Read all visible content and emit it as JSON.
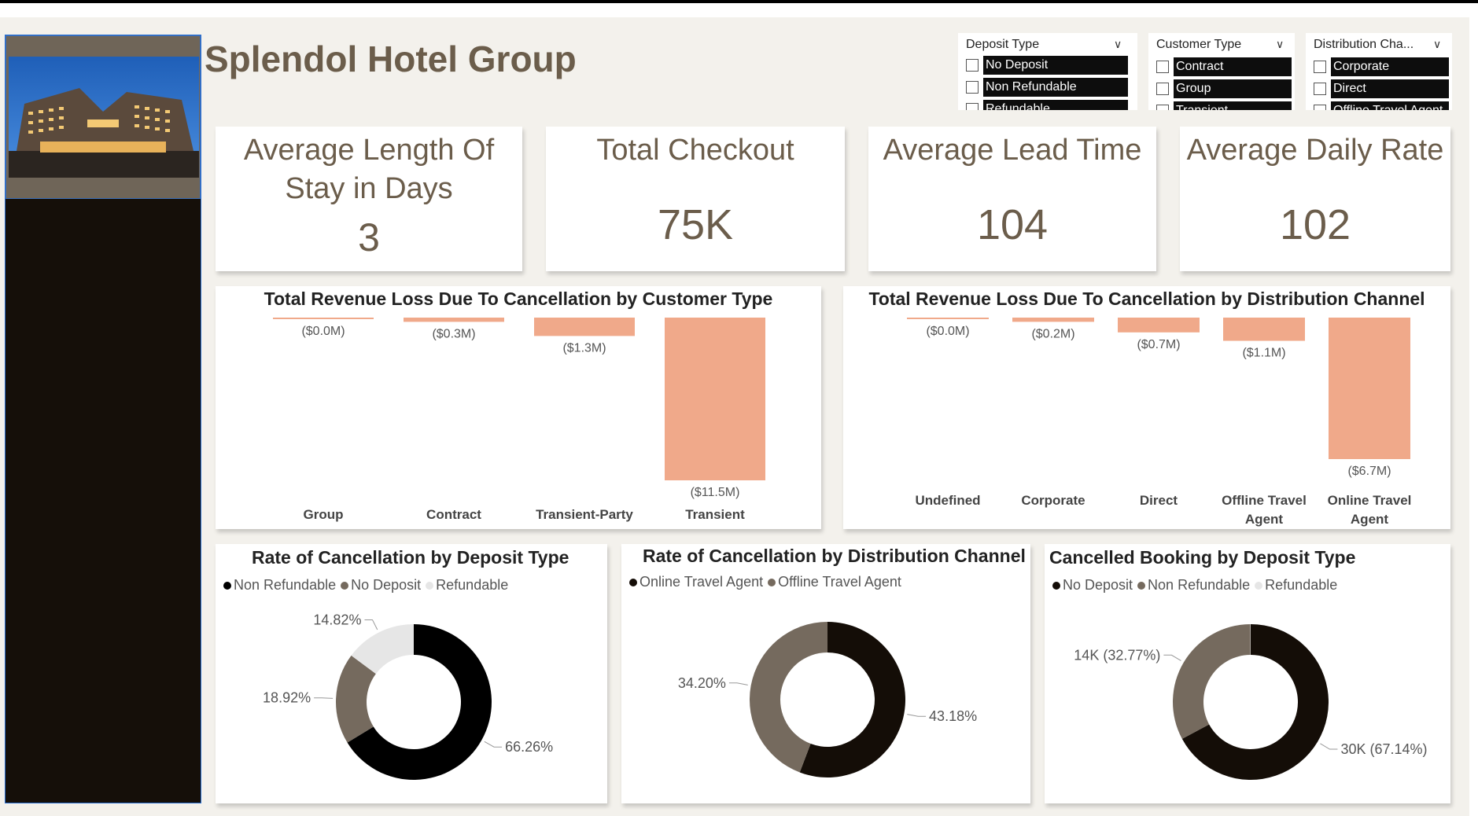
{
  "title": "Splendol Hotel Group",
  "slicers": [
    {
      "header": "Deposit Type",
      "options": [
        "No Deposit",
        "Non Refundable",
        "Refundable"
      ]
    },
    {
      "header": "Customer Type",
      "options": [
        "Contract",
        "Group",
        "Transient"
      ]
    },
    {
      "header": "Distribution Cha...",
      "options": [
        "Corporate",
        "Direct",
        "Offline Travel Agent"
      ]
    }
  ],
  "kpis": [
    {
      "title": "Average Length Of Stay in Days",
      "value": "3"
    },
    {
      "title": "Total Checkout",
      "value": "75K"
    },
    {
      "title": "Average Lead Time",
      "value": "104"
    },
    {
      "title": "Average Daily Rate",
      "value": "102"
    }
  ],
  "colors": {
    "bar": "#f0a98a",
    "dark": "#140d07",
    "brown": "#756a5e",
    "light": "#e6e6e6",
    "black": "#000000"
  },
  "chart_data": [
    {
      "type": "bar",
      "title": "Total Revenue Loss Due To Cancellation by Customer Type",
      "categories": [
        "Group",
        "Contract",
        "Transient-Party",
        "Transient"
      ],
      "values": [
        -0.02,
        -0.3,
        -1.3,
        -11.5
      ],
      "labels": [
        "($0.0M)",
        "($0.3M)",
        "($1.3M)",
        "($11.5M)"
      ],
      "unit": "$M"
    },
    {
      "type": "bar",
      "title": "Total Revenue Loss Due To Cancellation by Distribution Channel",
      "categories": [
        "Undefined",
        "Corporate",
        "Direct",
        "Offline Travel Agent",
        "Online Travel Agent"
      ],
      "values": [
        -0.02,
        -0.2,
        -0.7,
        -1.1,
        -6.7
      ],
      "labels": [
        "($0.0M)",
        "($0.2M)",
        "($0.7M)",
        "($1.1M)",
        "($6.7M)"
      ],
      "unit": "$M"
    },
    {
      "type": "pie",
      "title": "Rate of Cancellation by Deposit Type",
      "legend": [
        "Non Refundable",
        "No Deposit",
        "Refundable"
      ],
      "values": [
        66.26,
        18.92,
        14.82
      ],
      "labels": [
        "66.26%",
        "18.92%",
        "14.82%"
      ]
    },
    {
      "type": "pie",
      "title": "Rate of Cancellation by Distribution Channel",
      "legend": [
        "Online Travel Agent",
        "Offline Travel Agent"
      ],
      "values": [
        43.18,
        34.2
      ],
      "labels": [
        "43.18%",
        "34.20%"
      ]
    },
    {
      "type": "pie",
      "title": "Cancelled Booking by Deposit Type",
      "legend": [
        "No Deposit",
        "Non Refundable",
        "Refundable"
      ],
      "values": [
        67.14,
        32.77,
        0.09
      ],
      "labels": [
        "30K (67.14%)",
        "14K (32.77%)",
        ""
      ]
    }
  ]
}
